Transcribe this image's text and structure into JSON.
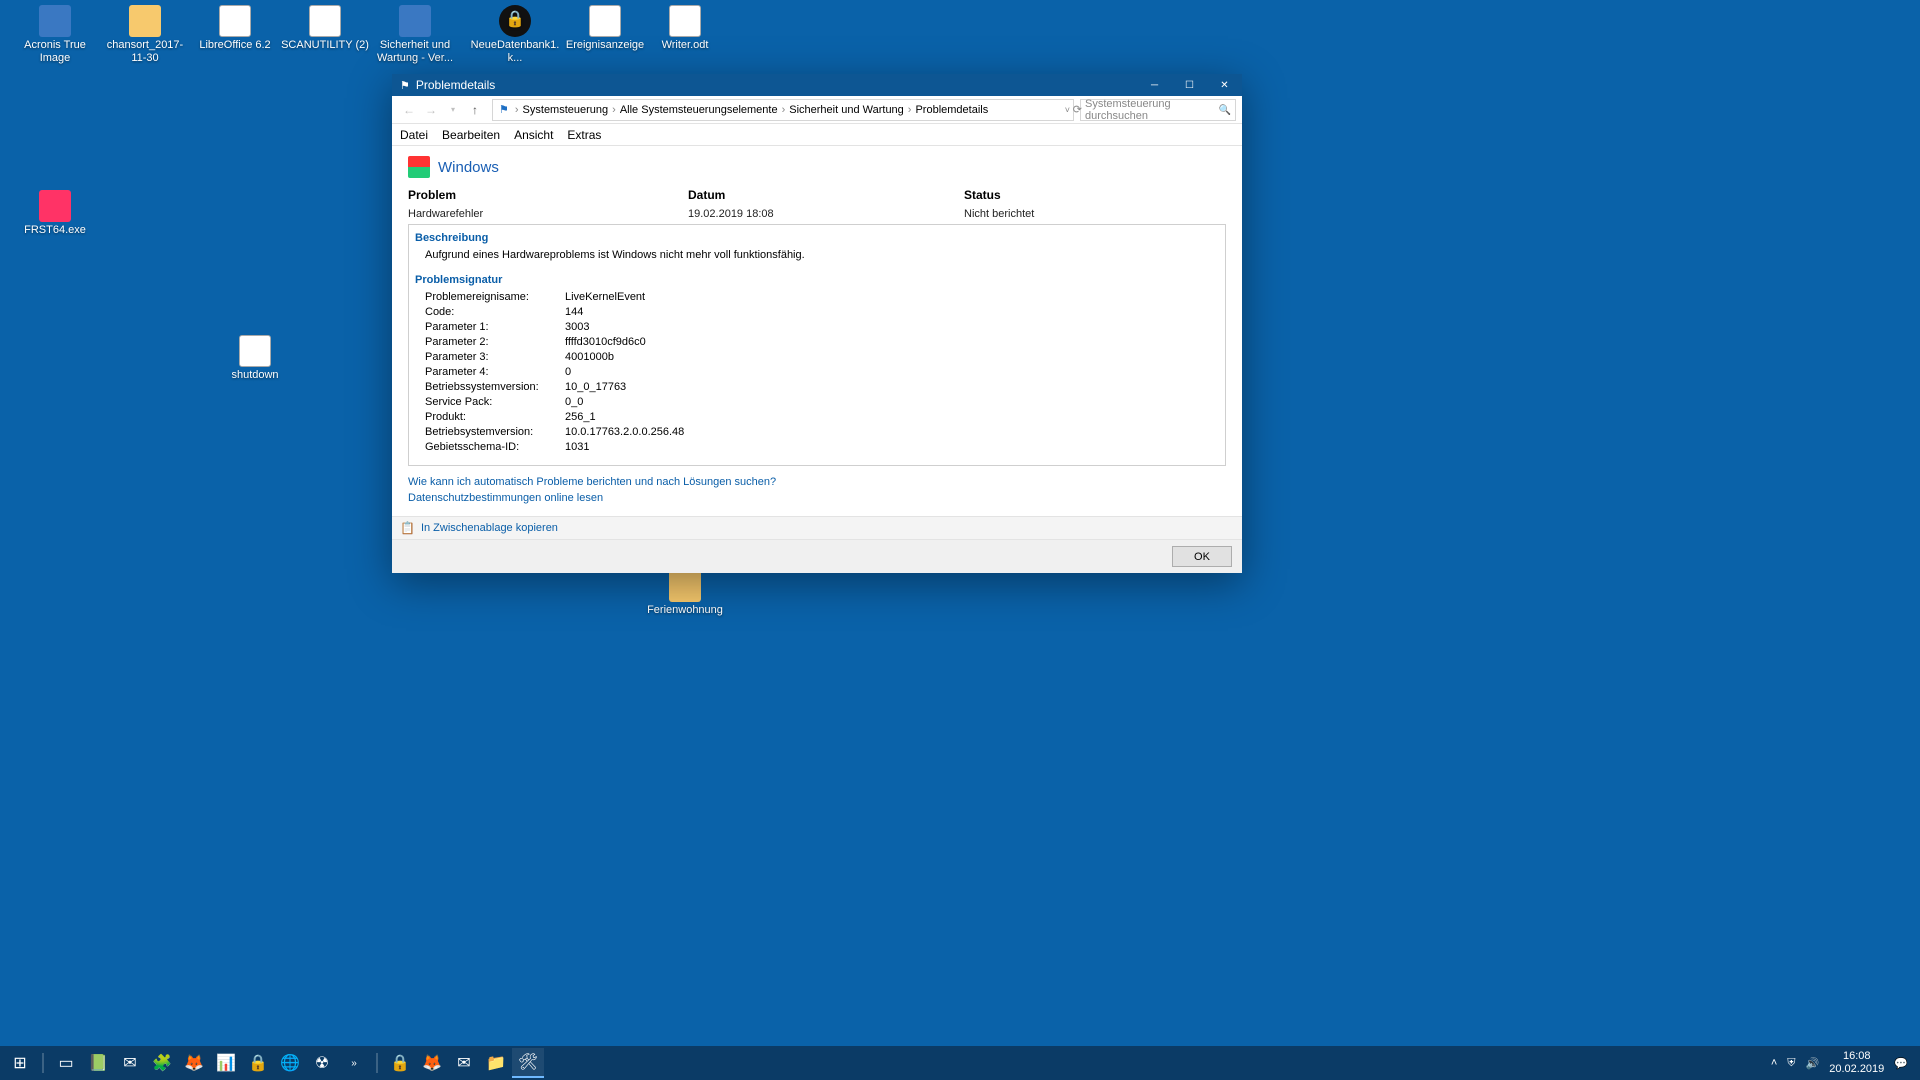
{
  "desktop_icons": {
    "i0": "Acronis True Image",
    "i1": "chansort_2017-11-30",
    "i2": "LibreOffice 6.2",
    "i3": "SCANUTILITY (2)",
    "i4": "Sicherheit und Wartung - Ver...",
    "i5": "NeueDatenbank1.k...",
    "i6": "Ereignisanzeige",
    "i7": "Writer.odt",
    "i8": "FRST64.exe",
    "i9": "shutdown",
    "i10": "Ferienwohnung"
  },
  "window": {
    "title": "Problemdetails",
    "breadcrumb": {
      "b0": "Systemsteuerung",
      "b1": "Alle Systemsteuerungselemente",
      "b2": "Sicherheit und Wartung",
      "b3": "Problemdetails"
    },
    "search_placeholder": "Systemsteuerung durchsuchen",
    "menu": {
      "m0": "Datei",
      "m1": "Bearbeiten",
      "m2": "Ansicht",
      "m3": "Extras"
    },
    "heading": "Windows",
    "headers": {
      "h0": "Problem",
      "h1": "Datum",
      "h2": "Status"
    },
    "values": {
      "v0": "Hardwarefehler",
      "v1": "19.02.2019 18:08",
      "v2": "Nicht berichtet"
    },
    "section1_title": "Beschreibung",
    "description": "Aufgrund eines Hardwareproblems ist Windows nicht mehr voll funktionsfähig.",
    "section2_title": "Problemsignatur",
    "sig": [
      {
        "k": "Problemereignisame:",
        "v": "LiveKernelEvent"
      },
      {
        "k": "Code:",
        "v": "144"
      },
      {
        "k": "Parameter 1:",
        "v": "3003"
      },
      {
        "k": "Parameter 2:",
        "v": "ffffd3010cf9d6c0"
      },
      {
        "k": "Parameter 3:",
        "v": "4001000b"
      },
      {
        "k": "Parameter 4:",
        "v": "0"
      },
      {
        "k": "Betriebssystemversion:",
        "v": "10_0_17763"
      },
      {
        "k": "Service Pack:",
        "v": "0_0"
      },
      {
        "k": "Produkt:",
        "v": "256_1"
      },
      {
        "k": "Betriebsystemversion:",
        "v": "10.0.17763.2.0.0.256.48"
      },
      {
        "k": "Gebietsschema-ID:",
        "v": "1031"
      }
    ],
    "link1": "Wie kann ich automatisch Probleme berichten und nach Lösungen suchen?",
    "link2": "Datenschutzbestimmungen online lesen",
    "copy_label": "In Zwischenablage kopieren",
    "ok_label": "OK"
  },
  "taskbar": {
    "time": "16:08",
    "date": "20.02.2019"
  }
}
